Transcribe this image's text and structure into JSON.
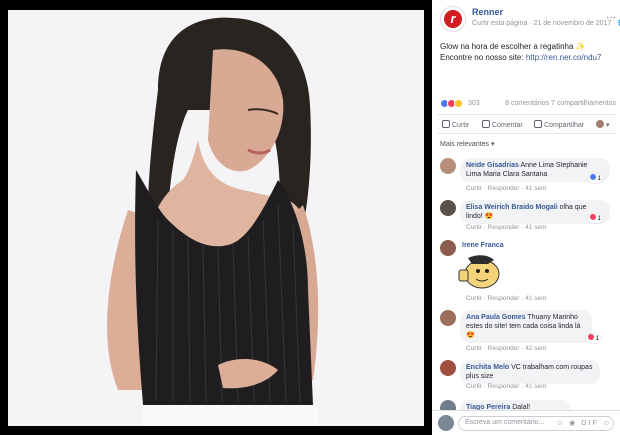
{
  "post": {
    "page_name": "Renner",
    "meta": "Curtir esta página · 21 de novembro de 2017 · ",
    "more_glyph": "···",
    "text": "Glow na hora de escolher a regatinha ✨ Encontre no nosso site: ",
    "link": "http://ren.ner.co/ndu7",
    "reaction_count": "303",
    "comments_shares": "8 comentários  7 compartilhamentos",
    "colors": {
      "brand": "#d21b22",
      "link": "#365899"
    }
  },
  "actions": {
    "like": "Curtir",
    "comment": "Comentar",
    "share": "Compartilhar"
  },
  "relevance_label": "Mais relevantes ▾",
  "comments": [
    {
      "author": "Neide Gisadrias",
      "text": "Anne Lima Stephanie Lima Maria Clara Santana",
      "meta": "Curtir · Responder · 41 sem",
      "reaction": "1"
    },
    {
      "author": "Elisa Weirich Braido Mogali",
      "text": "olha que lindo! 😍",
      "meta": "Curtir · Responder · 41 sem",
      "reaction": "1"
    },
    {
      "author": "Irene Franca",
      "text": "",
      "meta": "Curtir · Responder · 41 sem",
      "reaction": ""
    },
    {
      "author": "Ana Paula Gomes",
      "text": "Thuany Marinho estes do site! tem cada coisa linda lá 😍",
      "meta": "Curtir · Responder · 42 sem",
      "reaction": "1"
    },
    {
      "author": "Enchita Melo",
      "text": "VC trabalham com roupas plus size",
      "meta": "Curtir · Responder · 41 sem",
      "reaction": ""
    },
    {
      "author": "Tiago Pereira",
      "text": "Dalal!",
      "meta": "",
      "reaction": ""
    }
  ],
  "composer": {
    "placeholder": "Escreva um comentário...",
    "icons": "☺ ◉ GIF ☺"
  }
}
